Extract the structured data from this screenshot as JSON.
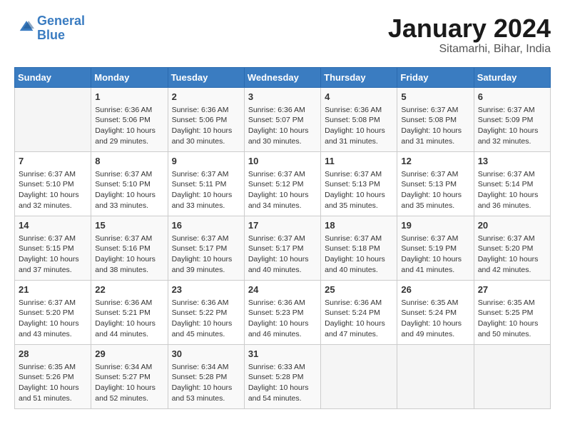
{
  "header": {
    "logo_line1": "General",
    "logo_line2": "Blue",
    "month": "January 2024",
    "location": "Sitamarhi, Bihar, India"
  },
  "weekdays": [
    "Sunday",
    "Monday",
    "Tuesday",
    "Wednesday",
    "Thursday",
    "Friday",
    "Saturday"
  ],
  "weeks": [
    [
      {
        "day": null
      },
      {
        "day": "1",
        "sunrise": "6:36 AM",
        "sunset": "5:06 PM",
        "daylight": "10 hours and 29 minutes."
      },
      {
        "day": "2",
        "sunrise": "6:36 AM",
        "sunset": "5:06 PM",
        "daylight": "10 hours and 30 minutes."
      },
      {
        "day": "3",
        "sunrise": "6:36 AM",
        "sunset": "5:07 PM",
        "daylight": "10 hours and 30 minutes."
      },
      {
        "day": "4",
        "sunrise": "6:36 AM",
        "sunset": "5:08 PM",
        "daylight": "10 hours and 31 minutes."
      },
      {
        "day": "5",
        "sunrise": "6:37 AM",
        "sunset": "5:08 PM",
        "daylight": "10 hours and 31 minutes."
      },
      {
        "day": "6",
        "sunrise": "6:37 AM",
        "sunset": "5:09 PM",
        "daylight": "10 hours and 32 minutes."
      }
    ],
    [
      {
        "day": "7",
        "sunrise": "6:37 AM",
        "sunset": "5:10 PM",
        "daylight": "10 hours and 32 minutes."
      },
      {
        "day": "8",
        "sunrise": "6:37 AM",
        "sunset": "5:10 PM",
        "daylight": "10 hours and 33 minutes."
      },
      {
        "day": "9",
        "sunrise": "6:37 AM",
        "sunset": "5:11 PM",
        "daylight": "10 hours and 33 minutes."
      },
      {
        "day": "10",
        "sunrise": "6:37 AM",
        "sunset": "5:12 PM",
        "daylight": "10 hours and 34 minutes."
      },
      {
        "day": "11",
        "sunrise": "6:37 AM",
        "sunset": "5:13 PM",
        "daylight": "10 hours and 35 minutes."
      },
      {
        "day": "12",
        "sunrise": "6:37 AM",
        "sunset": "5:13 PM",
        "daylight": "10 hours and 35 minutes."
      },
      {
        "day": "13",
        "sunrise": "6:37 AM",
        "sunset": "5:14 PM",
        "daylight": "10 hours and 36 minutes."
      }
    ],
    [
      {
        "day": "14",
        "sunrise": "6:37 AM",
        "sunset": "5:15 PM",
        "daylight": "10 hours and 37 minutes."
      },
      {
        "day": "15",
        "sunrise": "6:37 AM",
        "sunset": "5:16 PM",
        "daylight": "10 hours and 38 minutes."
      },
      {
        "day": "16",
        "sunrise": "6:37 AM",
        "sunset": "5:17 PM",
        "daylight": "10 hours and 39 minutes."
      },
      {
        "day": "17",
        "sunrise": "6:37 AM",
        "sunset": "5:17 PM",
        "daylight": "10 hours and 40 minutes."
      },
      {
        "day": "18",
        "sunrise": "6:37 AM",
        "sunset": "5:18 PM",
        "daylight": "10 hours and 40 minutes."
      },
      {
        "day": "19",
        "sunrise": "6:37 AM",
        "sunset": "5:19 PM",
        "daylight": "10 hours and 41 minutes."
      },
      {
        "day": "20",
        "sunrise": "6:37 AM",
        "sunset": "5:20 PM",
        "daylight": "10 hours and 42 minutes."
      }
    ],
    [
      {
        "day": "21",
        "sunrise": "6:37 AM",
        "sunset": "5:20 PM",
        "daylight": "10 hours and 43 minutes."
      },
      {
        "day": "22",
        "sunrise": "6:36 AM",
        "sunset": "5:21 PM",
        "daylight": "10 hours and 44 minutes."
      },
      {
        "day": "23",
        "sunrise": "6:36 AM",
        "sunset": "5:22 PM",
        "daylight": "10 hours and 45 minutes."
      },
      {
        "day": "24",
        "sunrise": "6:36 AM",
        "sunset": "5:23 PM",
        "daylight": "10 hours and 46 minutes."
      },
      {
        "day": "25",
        "sunrise": "6:36 AM",
        "sunset": "5:24 PM",
        "daylight": "10 hours and 47 minutes."
      },
      {
        "day": "26",
        "sunrise": "6:35 AM",
        "sunset": "5:24 PM",
        "daylight": "10 hours and 49 minutes."
      },
      {
        "day": "27",
        "sunrise": "6:35 AM",
        "sunset": "5:25 PM",
        "daylight": "10 hours and 50 minutes."
      }
    ],
    [
      {
        "day": "28",
        "sunrise": "6:35 AM",
        "sunset": "5:26 PM",
        "daylight": "10 hours and 51 minutes."
      },
      {
        "day": "29",
        "sunrise": "6:34 AM",
        "sunset": "5:27 PM",
        "daylight": "10 hours and 52 minutes."
      },
      {
        "day": "30",
        "sunrise": "6:34 AM",
        "sunset": "5:28 PM",
        "daylight": "10 hours and 53 minutes."
      },
      {
        "day": "31",
        "sunrise": "6:33 AM",
        "sunset": "5:28 PM",
        "daylight": "10 hours and 54 minutes."
      },
      {
        "day": null
      },
      {
        "day": null
      },
      {
        "day": null
      }
    ]
  ]
}
